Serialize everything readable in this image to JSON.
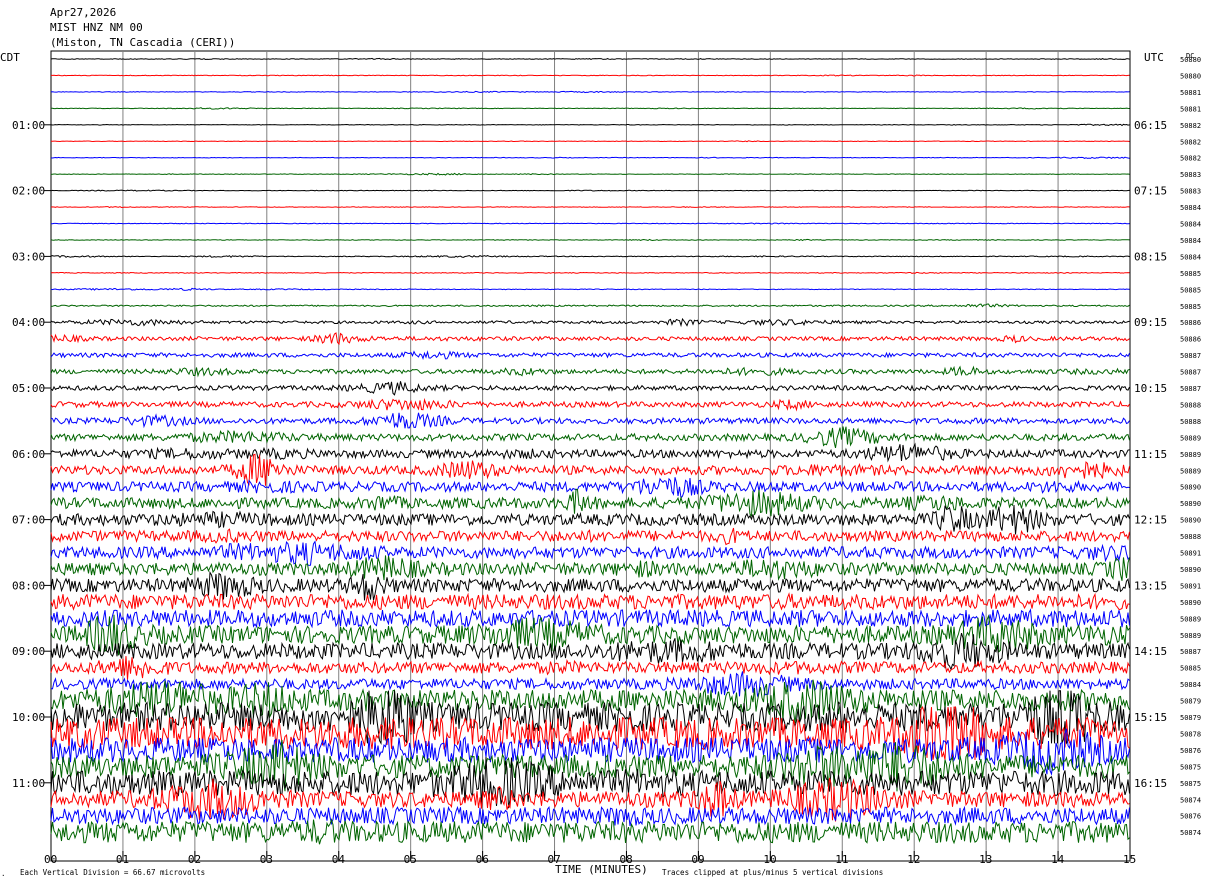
{
  "header": {
    "date": "Apr27,2026",
    "station": "MIST HNZ NM 00",
    "location": "(Miston, TN Cascadia (CERI))"
  },
  "left_timezone": "CDT",
  "right_timezone": "UTC",
  "dc_label": "DC",
  "footer": {
    "scale_note": "Each Vertical Division =   66.67 microvolts",
    "x_axis_label": "TIME (MINUTES)",
    "clip_note": "Traces clipped at plus/minus 5 vertical divisions",
    "corner_mark": "."
  },
  "colors": {
    "trace_cycle": [
      "#000000",
      "#ff0000",
      "#0000ff",
      "#006400"
    ],
    "grid": "#808080"
  },
  "chart_data": {
    "type": "line",
    "title": "",
    "xlabel": "TIME (MINUTES)",
    "xlim": [
      0,
      15
    ],
    "x_ticks": [
      "00",
      "01",
      "02",
      "03",
      "04",
      "05",
      "06",
      "07",
      "08",
      "09",
      "10",
      "11",
      "12",
      "13",
      "14",
      "15"
    ],
    "minutes_per_line": 15,
    "left_hour_labels": [
      "01:00",
      "02:00",
      "03:00",
      "04:00",
      "05:00",
      "06:00",
      "07:00",
      "08:00",
      "09:00",
      "10:00",
      "11:00"
    ],
    "right_hour_labels": [
      "06:15",
      "07:15",
      "08:15",
      "09:15",
      "10:15",
      "11:15",
      "12:15",
      "13:15",
      "14:15",
      "15:15",
      "16:15"
    ],
    "hour_label_first_line": 4,
    "dc_offsets": [
      "50880",
      "50880",
      "50881",
      "50881",
      "50882",
      "50882",
      "50882",
      "50883",
      "50883",
      "50884",
      "50884",
      "50884",
      "50884",
      "50885",
      "50885",
      "50885",
      "50886",
      "50886",
      "50887",
      "50887",
      "50887",
      "50888",
      "50888",
      "50889",
      "50889",
      "50889",
      "50890",
      "50890",
      "50890",
      "50888",
      "50891",
      "50890",
      "50891",
      "50890",
      "50889",
      "50889",
      "50887",
      "50885",
      "50884",
      "50879",
      "50879",
      "50878",
      "50876",
      "50875",
      "50875",
      "50874",
      "50876",
      "50874"
    ],
    "noise_level": [
      0.03,
      0.03,
      0.03,
      0.03,
      0.03,
      0.03,
      0.03,
      0.03,
      0.03,
      0.03,
      0.03,
      0.03,
      0.04,
      0.04,
      0.04,
      0.08,
      0.15,
      0.22,
      0.24,
      0.25,
      0.26,
      0.3,
      0.32,
      0.38,
      0.45,
      0.5,
      0.55,
      0.6,
      0.65,
      0.6,
      0.65,
      0.7,
      0.75,
      0.85,
      0.95,
      1.0,
      0.9,
      0.65,
      0.6,
      1.2,
      1.6,
      1.8,
      1.4,
      1.3,
      1.4,
      0.9,
      0.95,
      1.2
    ],
    "units": "microvolts per vertical division: 66.67"
  }
}
